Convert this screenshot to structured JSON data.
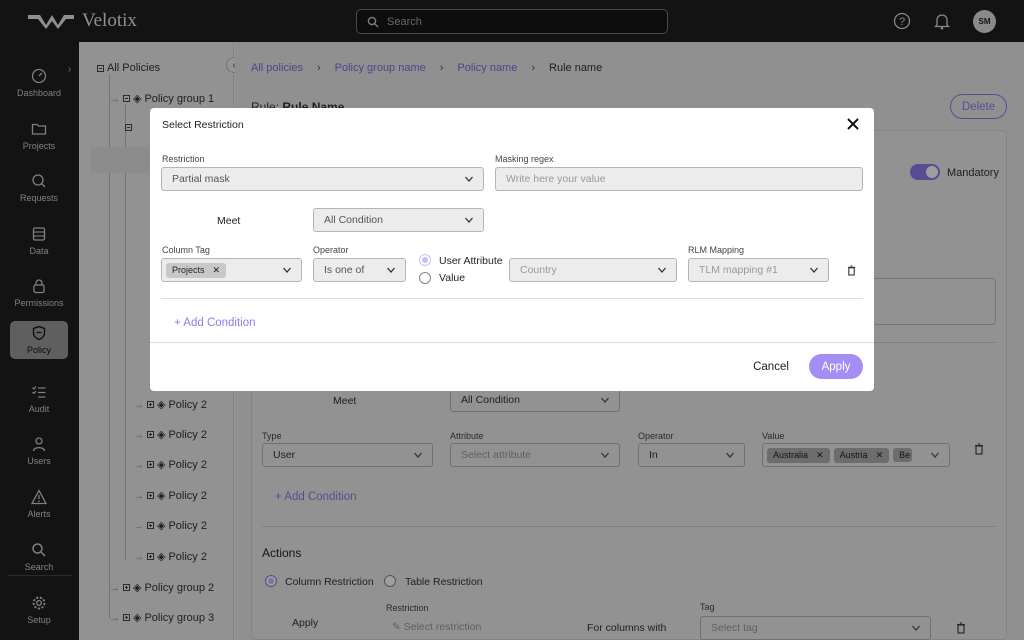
{
  "app": {
    "name": "Velotix",
    "search_placeholder": "Search",
    "avatar_initials": "SM"
  },
  "sidebar": {
    "items": [
      {
        "label": "Dashboard",
        "icon": "dashboard-icon"
      },
      {
        "label": "Projects",
        "icon": "folder-icon"
      },
      {
        "label": "Requests",
        "icon": "requests-icon"
      },
      {
        "label": "Data",
        "icon": "database-icon"
      },
      {
        "label": "Permissions",
        "icon": "lock-icon"
      },
      {
        "label": "Policy",
        "icon": "shield-icon",
        "active": true
      },
      {
        "label": "Audit",
        "icon": "audit-icon"
      },
      {
        "label": "Users",
        "icon": "user-icon"
      },
      {
        "label": "Alerts",
        "icon": "alert-icon"
      },
      {
        "label": "Search",
        "icon": "search-icon"
      },
      {
        "label": "Setup",
        "icon": "gear-icon"
      }
    ]
  },
  "tree": {
    "root": "All Policies",
    "group1": "Policy group 1",
    "policies": [
      "Policy 2",
      "Policy 2",
      "Policy 2",
      "Policy 2",
      "Policy 2",
      "Policy 2"
    ],
    "group2": "Policy group 2",
    "group3": "Policy group 3"
  },
  "breadcrumb": [
    "All policies",
    "Policy group name",
    "Policy name",
    "Rule name"
  ],
  "page": {
    "rule_prefix": "Rule:",
    "rule_name": "Rule Name",
    "delete_label": "Delete",
    "mandatory_label": "Mandatory"
  },
  "background_form": {
    "meet_label": "Meet",
    "meet_value": "All Condition",
    "type_label": "Type",
    "type_value": "User",
    "attribute_label": "Attribute",
    "attribute_placeholder": "Select attribute",
    "operator_label": "Operator",
    "operator_value": "In",
    "value_label": "Value",
    "value_chips": [
      "Australia",
      "Austria",
      "Be"
    ],
    "add_condition": "Add Condition",
    "actions_title": "Actions",
    "column_restriction": "Column Restriction",
    "table_restriction": "Table Restriction",
    "apply_label": "Apply",
    "restriction_label": "Restriction",
    "restriction_placeholder": "Select restriction",
    "for_columns_with": "For columns with",
    "tag_label": "Tag",
    "tag_placeholder": "Select tag"
  },
  "modal": {
    "title": "Select Restriction",
    "restriction_label": "Restriction",
    "restriction_value": "Partial mask",
    "masking_regex_label": "Masking regex",
    "masking_regex_placeholder": "Write here your value",
    "meet_label": "Meet",
    "meet_value": "All Condition",
    "column_tag_label": "Column Tag",
    "column_tag_chip": "Projects",
    "operator_label": "Operator",
    "operator_value": "Is one of",
    "user_attribute_label": "User Attribute",
    "value_option_label": "Value",
    "country_placeholder": "Country",
    "rlm_label": "RLM Mapping",
    "rlm_placeholder": "TLM mapping #1",
    "add_condition": "Add Condition",
    "cancel": "Cancel",
    "apply": "Apply"
  },
  "colors": {
    "accent": "#a48ef5",
    "link": "#7a6fe0",
    "topbar": "#1f1f1f"
  }
}
